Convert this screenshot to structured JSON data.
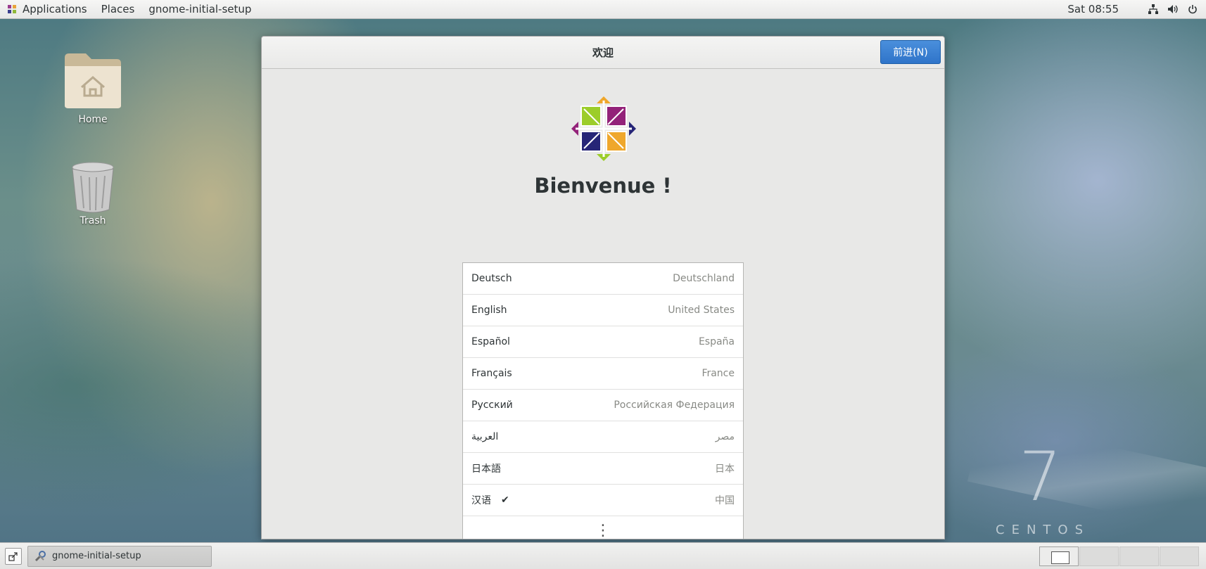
{
  "topbar": {
    "applications": "Applications",
    "places": "Places",
    "active_app": "gnome-initial-setup",
    "clock": "Sat 08:55",
    "icons": [
      "network-icon",
      "volume-icon",
      "power-icon"
    ]
  },
  "desktop": {
    "home_label": "Home",
    "trash_label": "Trash",
    "watermark_number": "7",
    "watermark_text": "CENTOS"
  },
  "window": {
    "title": "欢迎",
    "next_button": "前进(N)",
    "welcome_heading": "Bienvenue !",
    "logo": "centos-logo",
    "languages": [
      {
        "name": "Deutsch",
        "country": "Deutschland",
        "selected": false
      },
      {
        "name": "English",
        "country": "United States",
        "selected": false
      },
      {
        "name": "Español",
        "country": "España",
        "selected": false
      },
      {
        "name": "Français",
        "country": "France",
        "selected": false
      },
      {
        "name": "Русский",
        "country": "Российская Федерация",
        "selected": false
      },
      {
        "name": "العربية",
        "country": "مصر",
        "selected": false
      },
      {
        "name": "日本語",
        "country": "日本",
        "selected": false
      },
      {
        "name": "汉语",
        "country": "中国",
        "selected": true,
        "check_mark": "✔"
      }
    ],
    "more_glyph": "⋮"
  },
  "taskbar": {
    "task_label": "gnome-initial-setup",
    "workspaces": 4,
    "active_workspace": 1
  },
  "colors": {
    "accent": "#3a83d4",
    "window_bg": "#e8e8e7"
  }
}
